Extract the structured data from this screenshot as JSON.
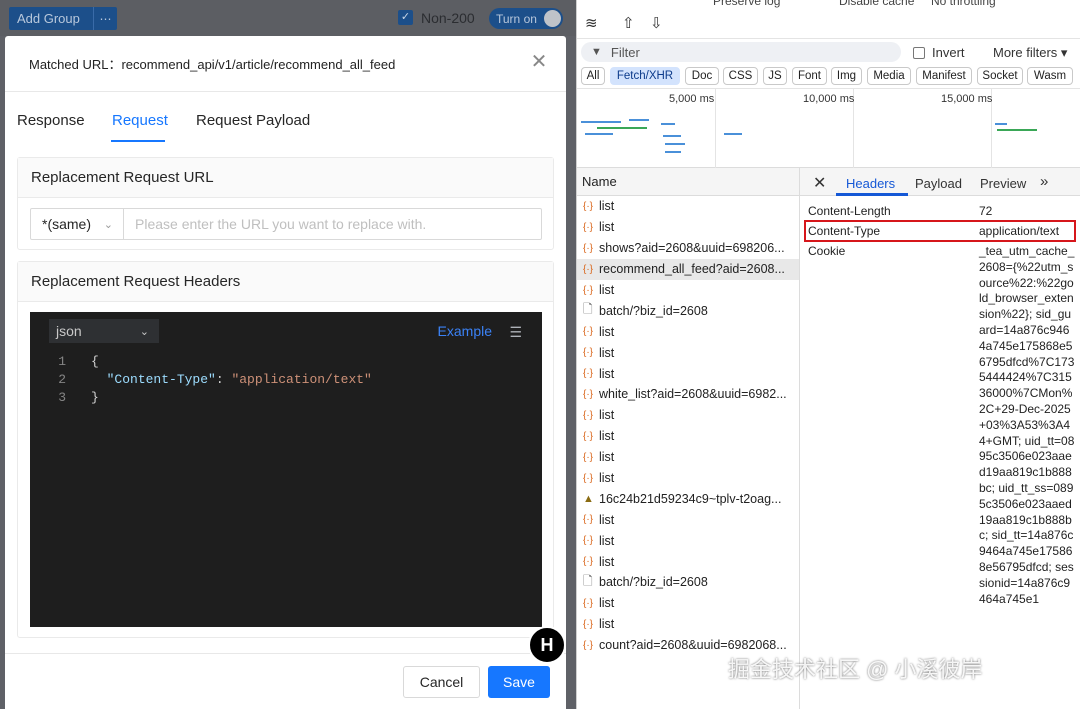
{
  "topbar": {
    "add_group": "Add Group",
    "more_icon": "ellipsis-icon",
    "non200_label": "Non-200",
    "toggle_label": "Turn on"
  },
  "modal": {
    "matched_url": "Matched URL：recommend_api/v1/article/recommend_all_feed",
    "tabs": [
      "Response",
      "Request",
      "Request Payload"
    ],
    "active_tab": "Request",
    "url_section_title": "Replacement Request URL",
    "url_select_value": "*(same)",
    "url_placeholder": "Please enter the URL you want to replace with.",
    "headers_section_title": "Replacement Request Headers",
    "editor_lang": "json",
    "example_label": "Example",
    "code_lines": [
      {
        "num": "1",
        "text": "{"
      },
      {
        "num": "2",
        "key": "\"Content-Type\"",
        "sep": ": ",
        "value": "\"application/text\""
      },
      {
        "num": "3",
        "text": "}"
      }
    ],
    "cancel_label": "Cancel",
    "save_label": "Save"
  },
  "devtools": {
    "top_row": [
      "Preserve log",
      "Disable cache",
      "No throttling"
    ],
    "filter_placeholder": "Filter",
    "invert_label": "Invert",
    "more_filters": "More filters ▾",
    "types": [
      "All",
      "Fetch/XHR",
      "Doc",
      "CSS",
      "JS",
      "Font",
      "Img",
      "Media",
      "Manifest",
      "Socket",
      "Wasm"
    ],
    "active_type": "Fetch/XHR",
    "timeline_labels": [
      "5,000 ms",
      "10,000 ms",
      "15,000 ms"
    ],
    "name_header": "Name",
    "requests": [
      {
        "name": "list",
        "kind": "xhr"
      },
      {
        "name": "list",
        "kind": "xhr"
      },
      {
        "name": "shows?aid=2608&uuid=698206...",
        "kind": "xhr"
      },
      {
        "name": "recommend_all_feed?aid=2608...",
        "kind": "xhr",
        "selected": true
      },
      {
        "name": "list",
        "kind": "xhr"
      },
      {
        "name": "batch/?biz_id=2608",
        "kind": "doc"
      },
      {
        "name": "list",
        "kind": "xhr"
      },
      {
        "name": "list",
        "kind": "xhr"
      },
      {
        "name": "list",
        "kind": "xhr"
      },
      {
        "name": "white_list?aid=2608&uuid=6982...",
        "kind": "xhr"
      },
      {
        "name": "list",
        "kind": "xhr"
      },
      {
        "name": "list",
        "kind": "xhr"
      },
      {
        "name": "list",
        "kind": "xhr"
      },
      {
        "name": "list",
        "kind": "xhr"
      },
      {
        "name": "16c24b21d59234c9~tplv-t2oag...",
        "kind": "img"
      },
      {
        "name": "list",
        "kind": "xhr"
      },
      {
        "name": "list",
        "kind": "xhr"
      },
      {
        "name": "list",
        "kind": "xhr"
      },
      {
        "name": "batch/?biz_id=2608",
        "kind": "doc"
      },
      {
        "name": "list",
        "kind": "xhr"
      },
      {
        "name": "list",
        "kind": "xhr"
      },
      {
        "name": "count?aid=2608&uuid=6982068...",
        "kind": "xhr"
      }
    ],
    "detail_tabs": [
      "Headers",
      "Payload",
      "Preview"
    ],
    "active_detail_tab": "Headers",
    "headers": [
      {
        "name": "Content-Length",
        "value": "72"
      },
      {
        "name": "Content-Type",
        "value": "application/text"
      },
      {
        "name": "Cookie",
        "value": ""
      }
    ],
    "cookie_value": "_tea_utm_cache_2608={%22utm_source%22:%22gold_browser_extension%22}; sid_guard=14a876c9464a745e175868e56795dfcd%7C1735444424%7C31536000%7CMon%2C+29-Dec-2025+03%3A53%3A44+GMT; uid_tt=0895c3506e023aaed19aa819c1b888bc; uid_tt_ss=0895c3506e023aaed19aa819c1b888bc; sid_tt=14a876c9464a745e175868e56795dfcd; sessionid=14a876c9464a745e1"
  },
  "watermark": "掘金技术社区 @ 小溪彼岸",
  "colors": {
    "accent": "#1677ff",
    "highlight": "#d6161b",
    "editor_bg": "#1e1e1e"
  }
}
